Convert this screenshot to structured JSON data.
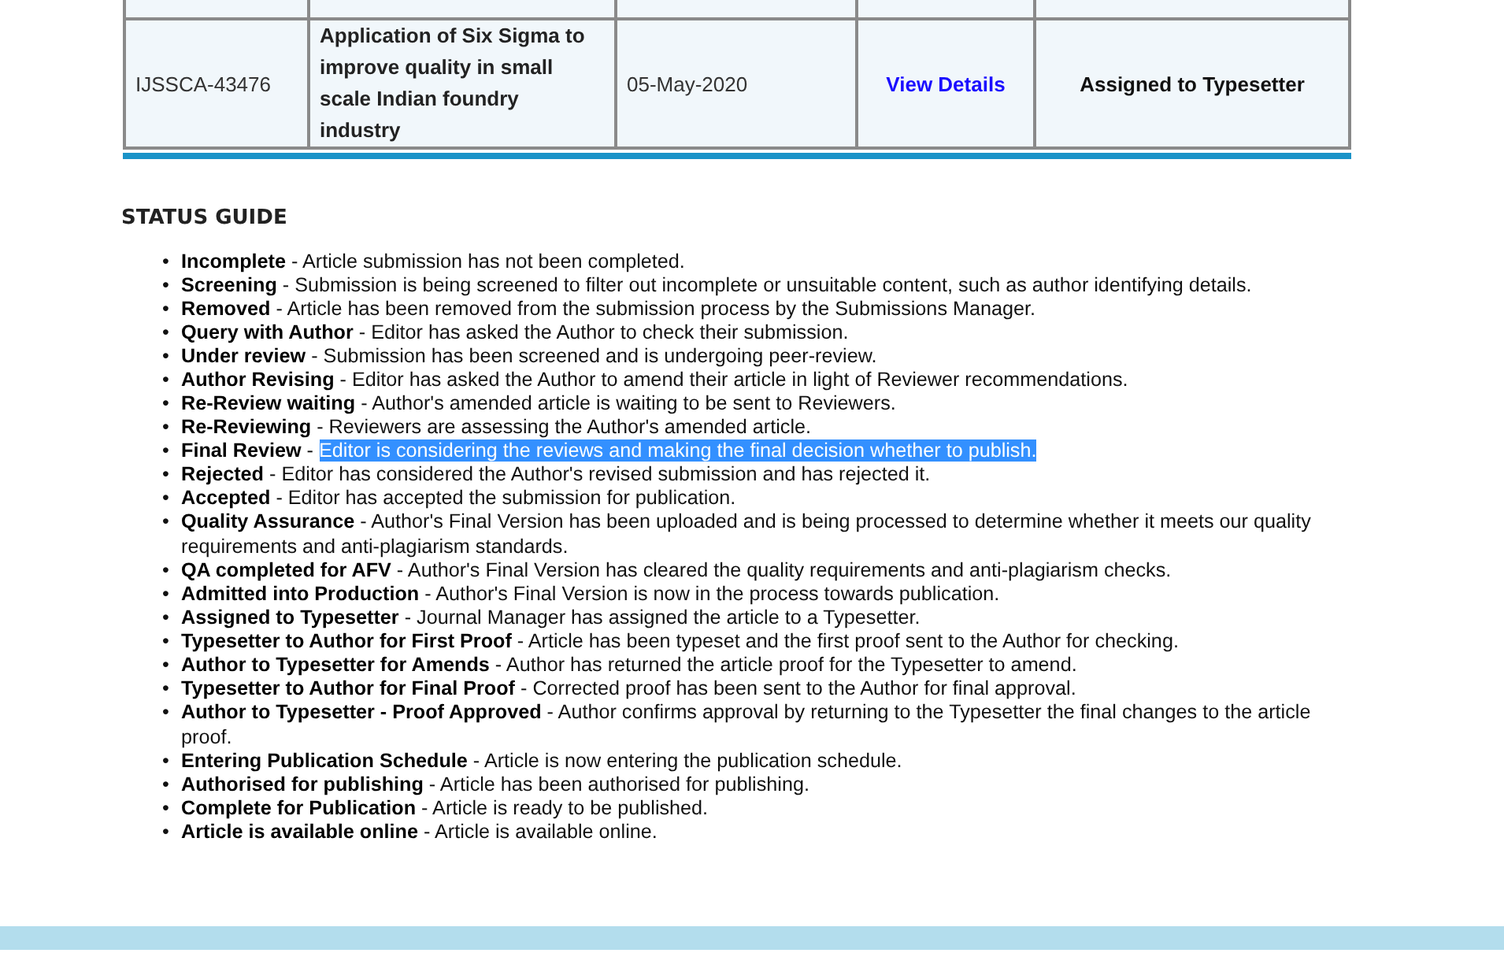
{
  "table": {
    "rows": [
      {
        "id": "IJSSCA-43476",
        "title": "Application of Six Sigma to improve quality in small scale Indian foundry industry",
        "date": "05-May-2020",
        "link": "View Details",
        "status": "Assigned to Typesetter"
      }
    ]
  },
  "status_guide": {
    "heading": "STATUS GUIDE",
    "bullet": "•",
    "separator": "-",
    "items": [
      {
        "name": "Incomplete",
        "description": "Article submission has not been completed.",
        "highlighted": false
      },
      {
        "name": "Screening",
        "description": "Submission is being screened to filter out incomplete or unsuitable content, such as author identifying details.",
        "highlighted": false
      },
      {
        "name": "Removed",
        "description": "Article has been removed from the submission process by the Submissions Manager.",
        "highlighted": false
      },
      {
        "name": "Query with Author",
        "description": "Editor has asked the Author to check their submission.",
        "highlighted": false
      },
      {
        "name": "Under review",
        "description": "Submission has been screened and is undergoing peer-review.",
        "highlighted": false
      },
      {
        "name": "Author Revising",
        "description": "Editor has asked the Author to amend their article in light of Reviewer recommendations.",
        "highlighted": false
      },
      {
        "name": "Re-Review waiting",
        "description": "Author's amended article is waiting to be sent to Reviewers.",
        "highlighted": false
      },
      {
        "name": "Re-Reviewing",
        "description": "Reviewers are assessing the Author's amended article.",
        "highlighted": false
      },
      {
        "name": "Final Review",
        "description": "Editor is considering the reviews and making the final decision whether to publish.",
        "highlighted": true
      },
      {
        "name": "Rejected",
        "description": "Editor has considered the Author's revised submission and has rejected it.",
        "highlighted": false
      },
      {
        "name": "Accepted",
        "description": "Editor has accepted the submission for publication.",
        "highlighted": false
      },
      {
        "name": "Quality Assurance",
        "description": "Author's Final Version has been uploaded and is being processed to determine whether it meets our quality requirements and anti-plagiarism standards.",
        "highlighted": false
      },
      {
        "name": "QA completed for AFV",
        "description": "Author's Final Version has cleared the quality requirements and anti-plagiarism checks.",
        "highlighted": false
      },
      {
        "name": "Admitted into Production",
        "description": "Author's Final Version is now in the process towards publication.",
        "highlighted": false
      },
      {
        "name": "Assigned to Typesetter",
        "description": "Journal Manager has assigned the article to a Typesetter.",
        "highlighted": false
      },
      {
        "name": "Typesetter to Author for First Proof",
        "description": "Article has been typeset and the first proof sent to the Author for checking.",
        "highlighted": false
      },
      {
        "name": "Author to Typesetter for Amends",
        "description": "Author has returned the article proof for the Typesetter to amend.",
        "highlighted": false
      },
      {
        "name": "Typesetter to Author for Final Proof",
        "description": "Corrected proof has been sent to the Author for final approval.",
        "highlighted": false
      },
      {
        "name": "Author to Typesetter - Proof Approved",
        "description": "Author confirms approval by returning to the Typesetter the final changes to the article proof.",
        "highlighted": false
      },
      {
        "name": "Entering Publication Schedule",
        "description": "Article is now entering the publication schedule.",
        "highlighted": false
      },
      {
        "name": "Authorised for publishing",
        "description": "Article has been authorised for publishing.",
        "highlighted": false
      },
      {
        "name": "Complete for Publication",
        "description": "Article is ready to be published.",
        "highlighted": false
      },
      {
        "name": "Article is available online",
        "description": "Article is available online.",
        "highlighted": false
      }
    ]
  }
}
